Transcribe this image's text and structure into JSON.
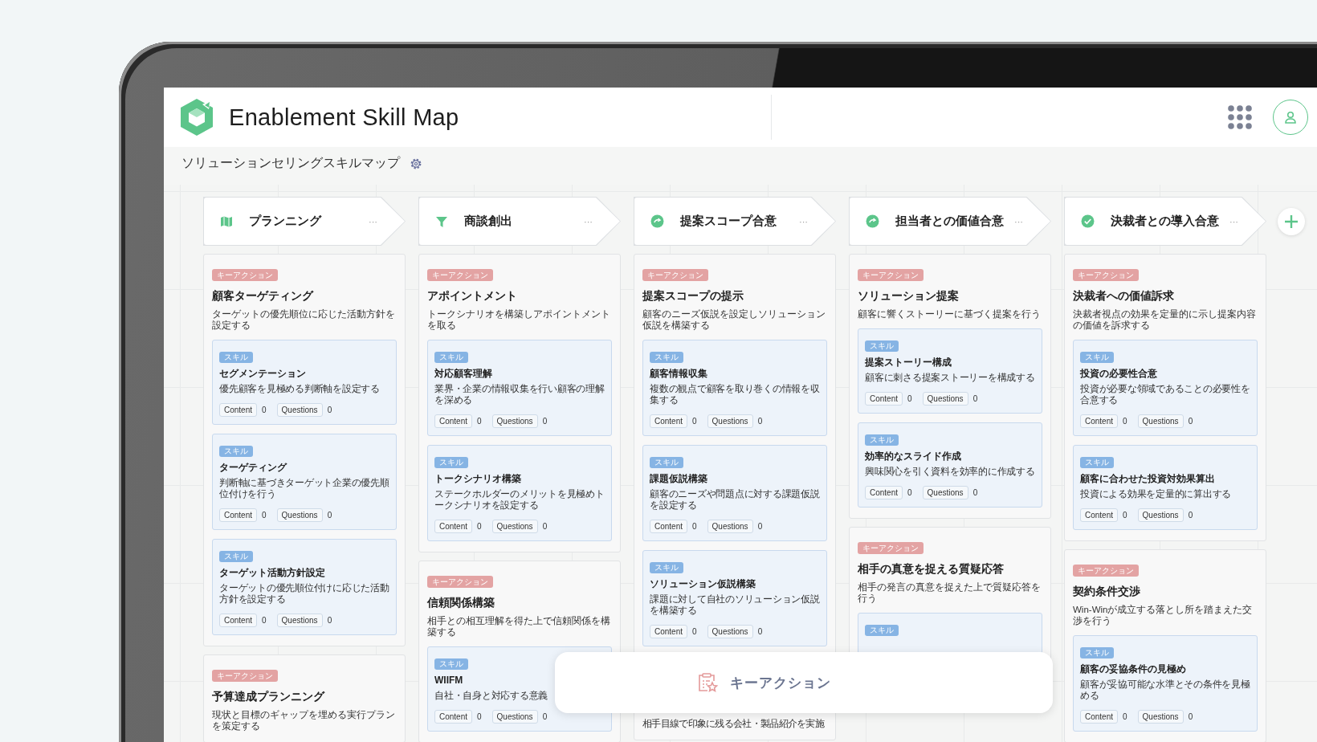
{
  "app": {
    "title": "Enablement Skill Map"
  },
  "map": {
    "title": "ソリューションセリングスキルマップ"
  },
  "stages": [
    {
      "kind": "map",
      "name": "プランニング",
      "menu": "···",
      "key_actions": [
        {
          "badge": "キーアクション",
          "title": "顧客ターゲティング",
          "description": "ターゲットの優先順位に応じた活動方針を設定する",
          "skills": [
            {
              "badge": "スキル",
              "title": "セグメンテーション",
              "description": "優先顧客を見極める判断軸を設定する",
              "content_label": "Content",
              "content_count": "0",
              "questions_label": "Questions",
              "questions_count": "0"
            },
            {
              "badge": "スキル",
              "title": "ターゲティング",
              "description": "判断軸に基づきターゲット企業の優先順位付けを行う",
              "content_label": "Content",
              "content_count": "0",
              "questions_label": "Questions",
              "questions_count": "0"
            },
            {
              "badge": "スキル",
              "title": "ターゲット活動方針設定",
              "description": "ターゲットの優先順位付けに応じた活動方針を設定する",
              "content_label": "Content",
              "content_count": "0",
              "questions_label": "Questions",
              "questions_count": "0"
            }
          ]
        },
        {
          "badge": "キーアクション",
          "title": "予算達成プランニング",
          "description": "現状と目標のギャップを埋める実行プランを策定する"
        }
      ]
    },
    {
      "kind": "funnel",
      "name": "商談創出",
      "menu": "···",
      "key_actions": [
        {
          "badge": "キーアクション",
          "title": "アポイントメント",
          "description": "トークシナリオを構築しアポイントメントを取る",
          "skills": [
            {
              "badge": "スキル",
              "title": "対応顧客理解",
              "description": "業界・企業の情報収集を行い顧客の理解を深める",
              "content_label": "Content",
              "content_count": "0",
              "questions_label": "Questions",
              "questions_count": "0"
            },
            {
              "badge": "スキル",
              "title": "トークシナリオ構築",
              "description": "ステークホルダーのメリットを見極めトークシナリオを設定する",
              "content_label": "Content",
              "content_count": "0",
              "questions_label": "Questions",
              "questions_count": "0"
            }
          ]
        },
        {
          "badge": "キーアクション",
          "title": "信頼関係構築",
          "description": "相手との相互理解を得た上で信頼関係を構築する",
          "skills": [
            {
              "badge": "スキル",
              "title": "WIIFM",
              "description": "自社・自身と対応する意義",
              "content_label": "Content",
              "content_count": "0",
              "questions_label": "Questions",
              "questions_count": "0"
            }
          ]
        }
      ]
    },
    {
      "kind": "progress",
      "name": "提案スコープ合意",
      "menu": "···",
      "key_actions": [
        {
          "badge": "キーアクション",
          "title": "提案スコープの提示",
          "description": "顧客のニーズ仮説を設定しソリューション仮説を構築する",
          "skills": [
            {
              "badge": "スキル",
              "title": "顧客情報収集",
              "description": "複数の観点で顧客を取り巻くの情報を収集する",
              "content_label": "Content",
              "content_count": "0",
              "questions_label": "Questions",
              "questions_count": "0"
            },
            {
              "badge": "スキル",
              "title": "課題仮説構築",
              "description": "顧客のニーズや問題点に対する課題仮説を設定する",
              "content_label": "Content",
              "content_count": "0",
              "questions_label": "Questions",
              "questions_count": "0"
            },
            {
              "badge": "スキル",
              "title": "ソリューション仮説構築",
              "description": "課題に対して自社のソリューション仮説を構築する",
              "content_label": "Content",
              "content_count": "0",
              "questions_label": "Questions",
              "questions_count": "0"
            }
          ]
        },
        {
          "description": "相手目線で印象に残る会社・製品紹介を実施"
        }
      ]
    },
    {
      "kind": "progress",
      "name": "担当者との価値合意",
      "menu": "···",
      "key_actions": [
        {
          "badge": "キーアクション",
          "title": "ソリューション提案",
          "description": "顧客に響くストーリーに基づく提案を行う",
          "skills": [
            {
              "badge": "スキル",
              "title": "提案ストーリー構成",
              "description": "顧客に刺さる提案ストーリーを構成する",
              "content_label": "Content",
              "content_count": "0",
              "questions_label": "Questions",
              "questions_count": "0"
            },
            {
              "badge": "スキル",
              "title": "効率的なスライド作成",
              "description": "興味関心を引く資料を効率的に作成する",
              "content_label": "Content",
              "content_count": "0",
              "questions_label": "Questions",
              "questions_count": "0"
            }
          ]
        },
        {
          "badge": "キーアクション",
          "title": "相手の真意を捉える質疑応答",
          "description": "相手の発言の真意を捉えた上で質疑応答を行う",
          "skills": [
            {
              "badge": "スキル"
            }
          ]
        }
      ]
    },
    {
      "kind": "check",
      "name": "決裁者との導入合意",
      "menu": "···",
      "key_actions": [
        {
          "badge": "キーアクション",
          "title": "決裁者への価値訴求",
          "description": "決裁者視点の効果を定量的に示し提案内容の価値を訴求する",
          "skills": [
            {
              "badge": "スキル",
              "title": "投資の必要性合意",
              "description": "投資が必要な領域であることの必要性を合意する",
              "content_label": "Content",
              "content_count": "0",
              "questions_label": "Questions",
              "questions_count": "0"
            },
            {
              "badge": "スキル",
              "title": "顧客に合わせた投資対効果算出",
              "description": "投資による効果を定量的に算出する",
              "content_label": "Content",
              "content_count": "0",
              "questions_label": "Questions",
              "questions_count": "0"
            }
          ]
        },
        {
          "badge": "キーアクション",
          "title": "契約条件交渉",
          "description": "Win-Winが成立する落とし所を踏まえた交渉を行う",
          "skills": [
            {
              "badge": "スキル",
              "title": "顧客の妥協条件の見極め",
              "description": "顧客が妥協可能な水準とその条件を見極める",
              "content_label": "Content",
              "content_count": "0",
              "questions_label": "Questions",
              "questions_count": "0"
            }
          ]
        }
      ]
    }
  ],
  "popup": {
    "label": "キーアクション"
  }
}
